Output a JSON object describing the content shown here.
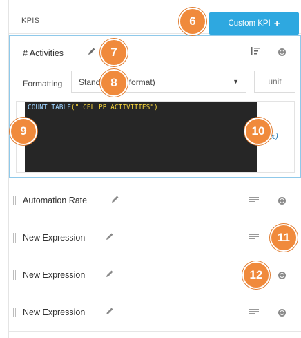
{
  "header": {
    "title": "KPIS",
    "custom_kpi_label": "Custom KPI",
    "custom_kpi_plus": "+"
  },
  "active_kpi": {
    "name": "# Activities",
    "formatting_label": "Formatting",
    "format_value": "Standard (no format)",
    "unit_placeholder": "unit",
    "code_fn": "COUNT_TABLE",
    "code_args": "(\"_CEL_PP_ACTIVITIES\")",
    "fx_label": "f(x)"
  },
  "kpi_rows": [
    {
      "label": "Automation Rate"
    },
    {
      "label": "New Expression"
    },
    {
      "label": "New Expression"
    },
    {
      "label": "New Expression"
    }
  ],
  "badges": [
    "6",
    "7",
    "8",
    "9",
    "10",
    "11",
    "12"
  ],
  "colors": {
    "accent": "#2ea8e0",
    "badge": "#f08a3c",
    "active_border": "#8fc9ea",
    "editor_bg": "#262626",
    "code_text": "#f2d13b"
  },
  "icons": {
    "edit": "pencil-icon",
    "sort": "sort-icon",
    "remove": "remove-icon",
    "drag": "drag-handle-icon",
    "format": "lines-icon",
    "formula": "fx-icon"
  }
}
